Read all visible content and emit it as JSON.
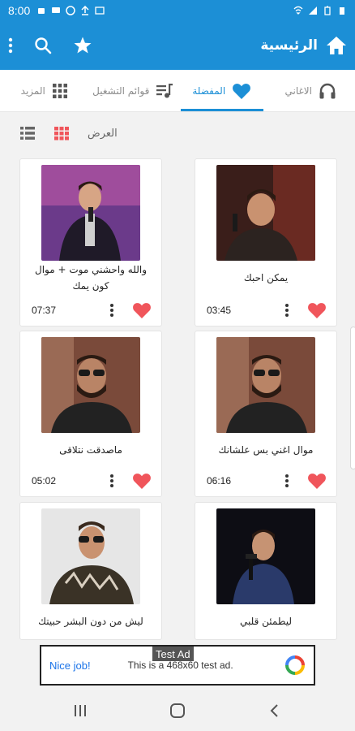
{
  "status": {
    "time": "8:00"
  },
  "appbar": {
    "title": "الرئيسية",
    "home_icon": "home-icon",
    "favorite_icon": "star-icon",
    "search_icon": "search-icon",
    "menu_icon": "overflow-menu-icon"
  },
  "tabs": [
    {
      "label": "الاغاني",
      "icon": "headphones-icon",
      "active": false
    },
    {
      "label": "المفضلة",
      "icon": "heart-icon",
      "active": true
    },
    {
      "label": "قوائم التشغيل",
      "icon": "playlist-icon",
      "active": false
    },
    {
      "label": "المزيد",
      "icon": "grid-icon",
      "active": false
    }
  ],
  "view": {
    "label": "العرض"
  },
  "songs": [
    {
      "title": "يمكن احبك",
      "duration": "03:45"
    },
    {
      "title": "والله واحشني موت + موال كون يمك",
      "duration": "07:37"
    },
    {
      "title": "موال اغني بس علشانك",
      "duration": "06:16"
    },
    {
      "title": "ماصدقت نتلاقى",
      "duration": "05:02"
    },
    {
      "title": "ليطمئن قلبي",
      "duration": ""
    },
    {
      "title": "ليش من دون البشر حبيتك",
      "duration": ""
    }
  ],
  "ad": {
    "tag": "Test Ad",
    "nice": "Nice job!",
    "text": "This is a 468x60 test ad."
  },
  "colors": {
    "accent": "#1c8fd6",
    "heart": "#f0555b"
  }
}
